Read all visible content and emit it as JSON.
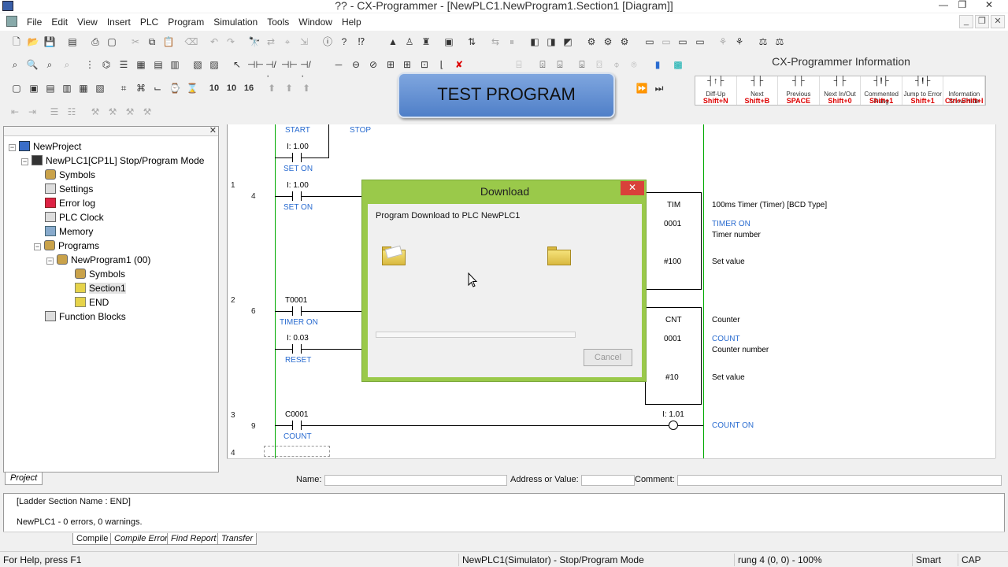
{
  "window": {
    "title": "?? - CX-Programmer - [NewPLC1.NewProgram1.Section1 [Diagram]]",
    "minimize": "—",
    "restore": "❐",
    "close": "✕"
  },
  "menu": {
    "items": [
      "File",
      "Edit",
      "View",
      "Insert",
      "PLC",
      "Program",
      "Simulation",
      "Tools",
      "Window",
      "Help"
    ]
  },
  "banner": {
    "text": "TEST PROGRAM"
  },
  "info_panel": {
    "title": "CX-Programmer Information",
    "keys": [
      {
        "sym": "┤↑├",
        "label": "Diff-Up",
        "shortcut": "Shift+N"
      },
      {
        "sym": "┤├",
        "label": "Next",
        "shortcut": "Shift+B"
      },
      {
        "sym": "┤├",
        "label": "Previous",
        "shortcut": "SPACE"
      },
      {
        "sym": "┤├",
        "label": "Next In/Out",
        "shortcut": "Shift+0"
      },
      {
        "sym": "┤!├",
        "label": "Commented Rung",
        "shortcut": "Shift+1"
      },
      {
        "sym": "┤!├",
        "label": "Jump to Error",
        "shortcut": "Shift+1"
      },
      {
        "sym": "",
        "label": "Information Show/Hide",
        "shortcut": "Ctrl+Shift+I"
      }
    ]
  },
  "project_tree": {
    "items": [
      {
        "label": "NewProject",
        "icon": "project-icon"
      },
      {
        "label": "NewPLC1[CP1L] Stop/Program Mode",
        "icon": "plc-icon"
      },
      {
        "label": "Symbols",
        "icon": "symbols-icon"
      },
      {
        "label": "Settings",
        "icon": "settings-icon"
      },
      {
        "label": "Error log",
        "icon": "error-log-icon"
      },
      {
        "label": "PLC Clock",
        "icon": "clock-icon"
      },
      {
        "label": "Memory",
        "icon": "memory-icon"
      },
      {
        "label": "Programs",
        "icon": "programs-icon"
      },
      {
        "label": "NewProgram1 (00)",
        "icon": "program-icon"
      },
      {
        "label": "Symbols",
        "icon": "symbols-icon"
      },
      {
        "label": "Section1",
        "icon": "section-icon"
      },
      {
        "label": "END",
        "icon": "section-icon"
      },
      {
        "label": "Function Blocks",
        "icon": "function-blocks-icon"
      }
    ],
    "tab": "Project"
  },
  "ladder": {
    "rungs": [
      {
        "num": "1",
        "step": "4"
      },
      {
        "num": "2",
        "step": "6"
      },
      {
        "num": "3",
        "step": "9"
      },
      {
        "num": "4",
        "step": ""
      }
    ],
    "labels": {
      "start": "START",
      "stop": "STOP",
      "i100a": "I: 1.00",
      "seton_a": "SET ON",
      "i100b": "I: 1.00",
      "seton_b": "SET ON",
      "tim": "TIM",
      "tim_comment": "100ms Timer (Timer) [BCD Type]",
      "timer_on": "TIMER ON",
      "tim_num": "0001",
      "timer_number": "Timer number",
      "tim_set": "#100",
      "set_value_a": "Set value",
      "t0001": "T0001",
      "timer_on_contact": "TIMER ON",
      "i003": "I: 0.03",
      "reset": "RESET",
      "cnt": "CNT",
      "counter": "Counter",
      "count": "COUNT",
      "cnt_num": "0001",
      "counter_number": "Counter number",
      "cnt_set": "#10",
      "set_value_b": "Set value",
      "c0001": "C0001",
      "count_contact": "COUNT",
      "i101": "I: 1.01",
      "count_on": "COUNT ON"
    }
  },
  "namebar": {
    "name_label": "Name:",
    "address_label": "Address or Value:",
    "comment_label": "Comment:"
  },
  "output": {
    "lines": [
      "[Ladder Section Name : END]",
      "NewPLC1 - 0 errors, 0 warnings."
    ],
    "tabs": [
      "Compile",
      "Compile Error",
      "Find Report",
      "Transfer"
    ]
  },
  "statusbar": {
    "help": "For Help, press F1",
    "mode": "NewPLC1(Simulator) - Stop/Program Mode",
    "position": "rung 4 (0, 0)  - 100%",
    "smart": "Smart",
    "cap": "CAP"
  },
  "download_dialog": {
    "title": "Download",
    "close": "✕",
    "message": "Program Download to PLC NewPLC1",
    "cancel": "Cancel",
    "progress": 0
  },
  "colors": {
    "dialog_frame": "#9ac94a",
    "close_red": "#d9413a",
    "symbol_blue": "#2a6cd0",
    "rail_green": "#00aa00"
  }
}
